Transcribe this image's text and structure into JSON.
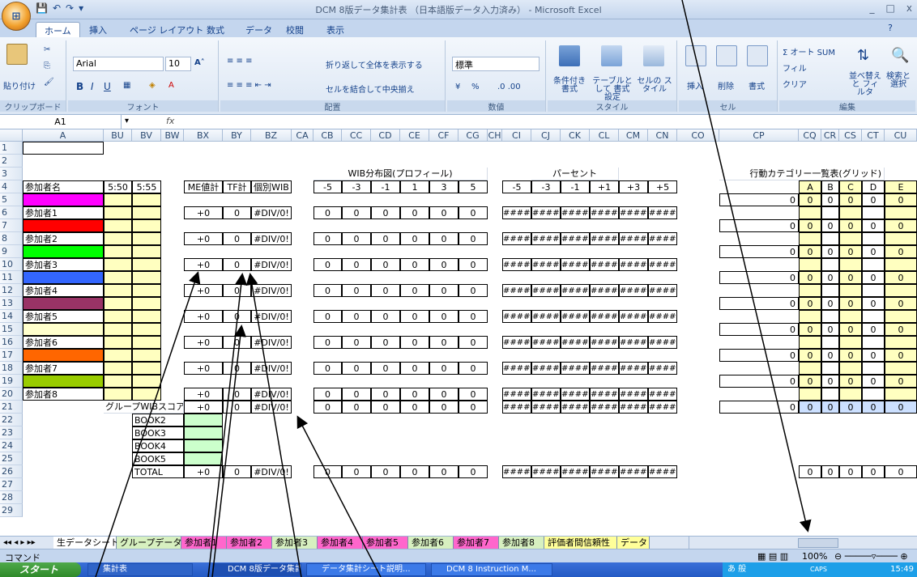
{
  "window": {
    "title": "DCM 8版データ集計表 （日本語版データ入力済み） - Microsoft Excel",
    "office_button": "Office",
    "controls": [
      "_",
      "□",
      "x"
    ]
  },
  "ribbon_tabs": [
    "ホーム",
    "挿入",
    "ページ レイアウト",
    "数式",
    "データ",
    "校閲",
    "表示"
  ],
  "ribbon": {
    "clipboard": {
      "paste": "貼り付け",
      "label": "クリップボード"
    },
    "font": {
      "name": "Arial",
      "size": "10",
      "label": "フォント",
      "bold": "B",
      "italic": "I",
      "underline": "U"
    },
    "alignment": {
      "wrap": "折り返して全体を表示する",
      "merge": "セルを結合して中央揃え",
      "label": "配置"
    },
    "number": {
      "format": "標準",
      "label": "数値",
      "percent": "%"
    },
    "styles": {
      "conditional": "条件付き 書式",
      "table": "テーブルとして 書式設定",
      "cell": "セルの スタイル",
      "label": "スタイル"
    },
    "cells": {
      "insert": "挿入",
      "delete": "削除",
      "format": "書式",
      "label": "セル"
    },
    "editing": {
      "autosum": "Σ オート SUM",
      "fill": "フィル",
      "clear": "クリア",
      "sort": "並べ替えと フィルタ",
      "find": "検索と 選択",
      "label": "編集"
    }
  },
  "formula_bar": {
    "name_box": "A1",
    "fx": "fx",
    "content": ""
  },
  "columns": [
    "A",
    "BU",
    "BV",
    "BW",
    "BX",
    "BY",
    "BZ",
    "CA",
    "CB",
    "CC",
    "CD",
    "CE",
    "CF",
    "CG",
    "CH",
    "CI",
    "CJ",
    "CK",
    "CL",
    "CM",
    "CN",
    "CO",
    "CP",
    "CQ",
    "CR",
    "CS",
    "CT",
    "CU"
  ],
  "rows": [
    "1",
    "2",
    "3",
    "4",
    "5",
    "6",
    "7",
    "8",
    "9",
    "10",
    "11",
    "12",
    "13",
    "14",
    "15",
    "16",
    "17",
    "18",
    "19",
    "20",
    "21",
    "22",
    "23",
    "24",
    "25",
    "26",
    "27",
    "28",
    "29"
  ],
  "sheet": {
    "wib_title": "WIB分布図(プロフィール)",
    "percent_title": "パーセント",
    "category_title": "行動カテゴリー一覧表(グリッド)",
    "header_participant": "参加者名",
    "header_t1": "5:50",
    "header_t2": "5:55",
    "header_me": "ME値計",
    "header_tf": "TF計",
    "header_wib": "個別WIB",
    "wib_bins": [
      "-5",
      "-3",
      "-1",
      "1",
      "3",
      "5"
    ],
    "pct_bins": [
      "-5",
      "-3",
      "-1",
      "+1",
      "+3",
      "+5"
    ],
    "cat_letters": [
      "A",
      "B",
      "C",
      "D",
      "E"
    ],
    "participants": [
      "参加者1",
      "参加者2",
      "参加者3",
      "参加者4",
      "参加者5",
      "参加者6",
      "参加者7",
      "参加者8"
    ],
    "participant_colors": [
      "#ff00ff",
      "#ff0000",
      "#00ff00",
      "#3366ff",
      "#993366",
      "#ffffcc",
      "#ff6600",
      "#99cc00"
    ],
    "me_value": "+0",
    "tf_value": "0",
    "wib_error": "#DIV/0!",
    "zero": "0",
    "hash": "#####",
    "group_label": "グループWIBスコア",
    "books": [
      "BOOK2",
      "BOOK3",
      "BOOK4",
      "BOOK5"
    ],
    "total": "TOTAL"
  },
  "sheet_tabs": [
    "生データシート",
    "グループデータ",
    "参加者1",
    "参加者2",
    "参加者3",
    "参加者4",
    "参加者5",
    "参加者6",
    "参加者7",
    "参加者8",
    "評価者間信頼性",
    "データ"
  ],
  "status": {
    "mode": "コマンド",
    "zoom": "100%"
  },
  "taskbar": {
    "start": "スタート",
    "items": [
      "集計表",
      "DCM 8版データ集計...",
      "データ集計シート説明...",
      "DCM 8 Instruction M..."
    ],
    "clock": "15:49",
    "caps": "CAPS"
  }
}
